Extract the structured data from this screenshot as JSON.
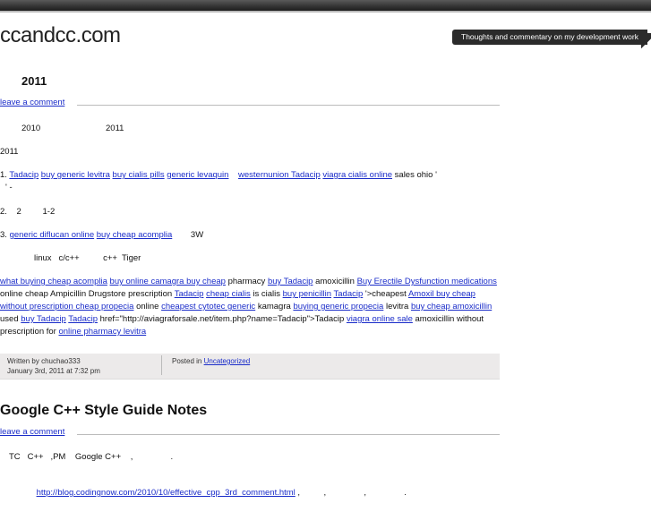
{
  "header": {
    "site_title": "ccandcc.com",
    "tagline": "Thoughts and commentary on my development work"
  },
  "post1": {
    "title": "2011",
    "comment_link": "leave a comment",
    "line1_a": "2010",
    "line1_b": "2011",
    "line2": "2011",
    "item1_prefix": "1.",
    "item1_links": [
      "Tadacip",
      "buy generic levitra",
      "buy cialis pills",
      "generic levaquin",
      "westernunion Tadacip",
      "viagra cialis online"
    ],
    "item1_suffix": "sales ohio '",
    "item1_cont": "' -",
    "item2": "2.    2         1-2",
    "item3_prefix": "3.",
    "item3_link1": "generic diflucan online",
    "item3_link2": "buy cheap acomplia",
    "item3_suffix": "3W",
    "tools_line": "linux   c/c++          c++  Tiger",
    "spam": {
      "l1": "what buying cheap acomplia",
      "l2": "buy online camagra buy cheap",
      "t3": "pharmacy",
      "l4": "buy Tadacip",
      "t5": "amoxicillin",
      "l6": "Buy Erectile Dysfunction medications",
      "t7": "online cheap Ampicillin Drugstore prescription",
      "l8": "Tadacip",
      "l9": "cheap cialis",
      "t10": "is cialis",
      "l11": "buy penicillin",
      "l12": "Tadacip",
      "t13": "'>cheapest",
      "l14": "Amoxil buy cheap without prescription cheap propecia",
      "t15": "online",
      "l16": "cheapest cytotec generic",
      "t17": "kamagra",
      "l18": "buying generic propecia",
      "t19": "levitra",
      "l20": "buy cheap amoxicillin",
      "t21": "used",
      "l22": "buy Tadacip",
      "l23": "Tadacip",
      "t24": "href=\"http://aviagraforsale.net/item.php?name=Tadacip\">Tadacip",
      "l25": "viagra online sale",
      "t26": "amoxicillin without prescription for",
      "l27": "online pharmacy levitra"
    },
    "meta": {
      "written_by": "Written by chuchao333",
      "date": "January 3rd, 2011 at 7:32 pm",
      "posted_in": "Posted in",
      "category": "Uncategorized"
    }
  },
  "post2": {
    "title": "Google C++ Style Guide Notes",
    "comment_link": "leave a comment",
    "line1": "TC   C++   ,PM    Google C++    ,                .",
    "link": "http://blog.codingnow.com/2010/10/effective_cpp_3rd_comment.html",
    "link_suffix": " ,          ,                ,                ."
  }
}
